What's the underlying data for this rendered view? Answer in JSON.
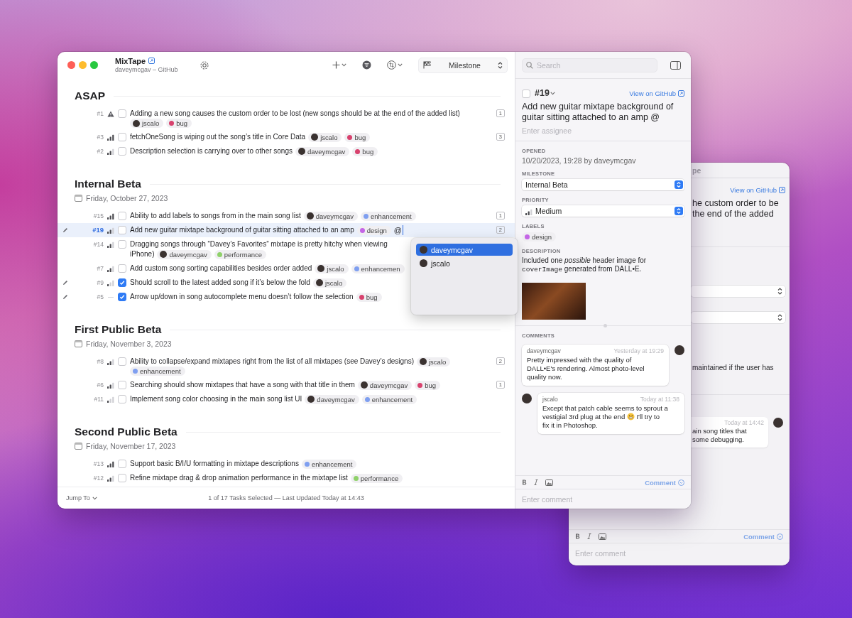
{
  "window": {
    "title": "MixTape",
    "subtitle": "daveymcgav – GitHub",
    "milestone_select": "Milestone"
  },
  "sections": [
    {
      "title": "ASAP",
      "tasks": [
        {
          "number": "#1",
          "priority": {
            "kind": "urgent"
          },
          "checked": false,
          "selected": false,
          "edited": false,
          "title": "Adding a new song causes the custom order to be lost (new songs should be at the end of the added list)",
          "assignee": {
            "name": "jscalo"
          },
          "labels": [
            {
              "name": "bug",
              "color": "#d8426e"
            }
          ],
          "comments": "1"
        },
        {
          "number": "#3",
          "priority": {
            "kind": "high"
          },
          "checked": false,
          "selected": false,
          "edited": false,
          "title": "fetchOneSong is wiping out the song’s title in Core Data",
          "assignee": {
            "name": "jscalo"
          },
          "labels": [
            {
              "name": "bug",
              "color": "#d8426e"
            }
          ],
          "comments": "3"
        },
        {
          "number": "#2",
          "priority": {
            "kind": "medium"
          },
          "checked": false,
          "selected": false,
          "edited": false,
          "title": "Description selection is carrying over to other songs",
          "assignee": {
            "name": "daveymcgav"
          },
          "labels": [
            {
              "name": "bug",
              "color": "#d8426e"
            }
          ]
        }
      ]
    },
    {
      "title": "Internal Beta",
      "date": "Friday, October 27, 2023",
      "tasks": [
        {
          "number": "#15",
          "priority": {
            "kind": "high"
          },
          "checked": false,
          "selected": false,
          "edited": false,
          "title": "Ability to add labels to songs from in the main song list",
          "assignee": {
            "name": "daveymcgav"
          },
          "labels": [
            {
              "name": "enhancement",
              "color": "#7f9ff0"
            }
          ],
          "comments": "1"
        },
        {
          "number": "#19",
          "priority": {
            "kind": "medium"
          },
          "checked": false,
          "selected": true,
          "edited": true,
          "title": "Add new guitar mixtape background of guitar sitting attached to an amp",
          "labels": [
            {
              "name": "design",
              "color": "#c466e6"
            }
          ],
          "typed": "@",
          "comments": "2"
        },
        {
          "number": "#14",
          "priority": {
            "kind": "medium"
          },
          "checked": false,
          "selected": false,
          "edited": false,
          "title": "Dragging songs through “Davey’s Favorites” mixtape is pretty hitchy when viewing",
          "title_line_2": "iPhone)",
          "assignee": {
            "name": "daveymcgav"
          },
          "labels": [
            {
              "name": "performance",
              "color": "#8fd16a"
            }
          ]
        },
        {
          "number": "#7",
          "priority": {
            "kind": "medium"
          },
          "checked": false,
          "selected": false,
          "edited": false,
          "title": "Add custom song sorting capabilities besides order added",
          "assignee": {
            "name": "jscalo"
          },
          "labels": [
            {
              "name": "enhancemen",
              "color": "#7f9ff0"
            }
          ]
        },
        {
          "number": "#9",
          "priority": {
            "kind": "low"
          },
          "checked": true,
          "selected": false,
          "edited": true,
          "title": "Should scroll to the latest added song if it’s below the fold",
          "assignee": {
            "name": "jscalo"
          }
        },
        {
          "number": "#5",
          "priority": {
            "kind": "none"
          },
          "checked": true,
          "selected": false,
          "edited": true,
          "title": "Arrow up/down in song autocomplete menu doesn’t follow the selection",
          "labels": [
            {
              "name": "bug",
              "color": "#d8426e"
            }
          ]
        }
      ]
    },
    {
      "title": "First Public Beta",
      "date": "Friday, November 3, 2023",
      "tasks": [
        {
          "number": "#8",
          "priority": {
            "kind": "medium"
          },
          "checked": false,
          "selected": false,
          "edited": false,
          "title": "Ability to collapse/expand mixtapes right from the list of all mixtapes (see Davey’s designs)",
          "assignee": {
            "name": "jscalo"
          },
          "labels": [
            {
              "name": "enhancement",
              "color": "#7f9ff0"
            }
          ],
          "comments": "2"
        },
        {
          "number": "#6",
          "priority": {
            "kind": "medium"
          },
          "checked": false,
          "selected": false,
          "edited": false,
          "title": "Searching should show mixtapes that have a song with that title in them",
          "assignee": {
            "name": "daveymcgav"
          },
          "labels": [
            {
              "name": "bug",
              "color": "#d8426e"
            }
          ],
          "comments": "1"
        },
        {
          "number": "#11",
          "priority": {
            "kind": "low"
          },
          "checked": false,
          "selected": false,
          "edited": false,
          "title": "Implement song color choosing in the main song list UI",
          "assignee": {
            "name": "daveymcgav"
          },
          "labels": [
            {
              "name": "enhancement",
              "color": "#7f9ff0"
            }
          ]
        }
      ]
    },
    {
      "title": "Second Public Beta",
      "date": "Friday, November 17, 2023",
      "tasks": [
        {
          "number": "#13",
          "priority": {
            "kind": "high"
          },
          "checked": false,
          "selected": false,
          "edited": false,
          "title": "Support basic B/I/U formatting in mixtape descriptions",
          "labels": [
            {
              "name": "enhancement",
              "color": "#7f9ff0"
            }
          ]
        },
        {
          "number": "#12",
          "priority": {
            "kind": "medium"
          },
          "checked": false,
          "selected": false,
          "edited": false,
          "title": "Refine mixtape drag & drop animation performance in the mixtape list",
          "labels": [
            {
              "name": "performance",
              "color": "#8fd16a"
            }
          ]
        }
      ]
    }
  ],
  "mention_menu": {
    "items": [
      {
        "name": "daveymcgav",
        "selected": true
      },
      {
        "name": "jscalo",
        "selected": false
      }
    ]
  },
  "footer": {
    "jump_to": "Jump To",
    "status": "1 of 17 Tasks Selected — Last Updated Today at 14:43"
  },
  "detail": {
    "search_placeholder": "Search",
    "checked": false,
    "number": "#19",
    "view_link": "View on GitHub",
    "title": "Add new guitar mixtape background of guitar sitting attached to an amp @",
    "assignee_placeholder": "Enter assignee",
    "fields": [
      {
        "label": "OPENED",
        "kind": "text",
        "value": "10/20/2023, 19:28 by daveymcgav"
      },
      {
        "label": "MILESTONE",
        "kind": "select",
        "value": "Internal Beta"
      },
      {
        "label": "PRIORITY",
        "kind": "select",
        "value": "Medium",
        "priority": {
          "kind": "medium"
        }
      },
      {
        "label": "LABELS",
        "kind": "labels",
        "labels": [
          {
            "name": "design",
            "color": "#c466e6"
          }
        ]
      }
    ],
    "description_label": "DESCRIPTION",
    "description": [
      {
        "kind": "text",
        "text": "Included one *possible* header image for "
      },
      {
        "kind": "code",
        "text": "coverImage"
      },
      {
        "kind": "text",
        "text": " generated from DALL•E."
      }
    ],
    "comments_label": "COMMENTS",
    "comments": [
      {
        "kind": "right",
        "author": "daveymcgav",
        "time": "Yesterday at 19:29",
        "lines": [
          {
            "parts": [
              "Pretty impressed with the quality of"
            ]
          },
          {
            "parts": [
              "DALL•E's rendering. Almost photo-level"
            ]
          },
          {
            "parts": [
              "quality now."
            ]
          }
        ]
      },
      {
        "kind": "left",
        "author": "jscalo",
        "time": "Today at 11:38",
        "lines": [
          {
            "parts": [
              "Except that patch cable seems to sprout a"
            ]
          },
          {
            "parts": [
              "vestigial 3rd plug at the end",
              "I'll try to"
            ]
          },
          {
            "parts": [
              "fix it in Photoshop."
            ]
          }
        ]
      }
    ],
    "comment_button": "Comment",
    "comment_placeholder": "Enter comment"
  },
  "background_window": {
    "title": "pe",
    "view_link": "View on GitHub",
    "title_lines": [
      "he custom order to be",
      "the end of the added"
    ],
    "description": "maintained if the user has",
    "comment": {
      "time": "Today at 14:42",
      "lines": [
        "ain song titles that",
        "some debugging."
      ]
    },
    "comment_button": "Comment",
    "comment_placeholder": "Enter comment"
  }
}
